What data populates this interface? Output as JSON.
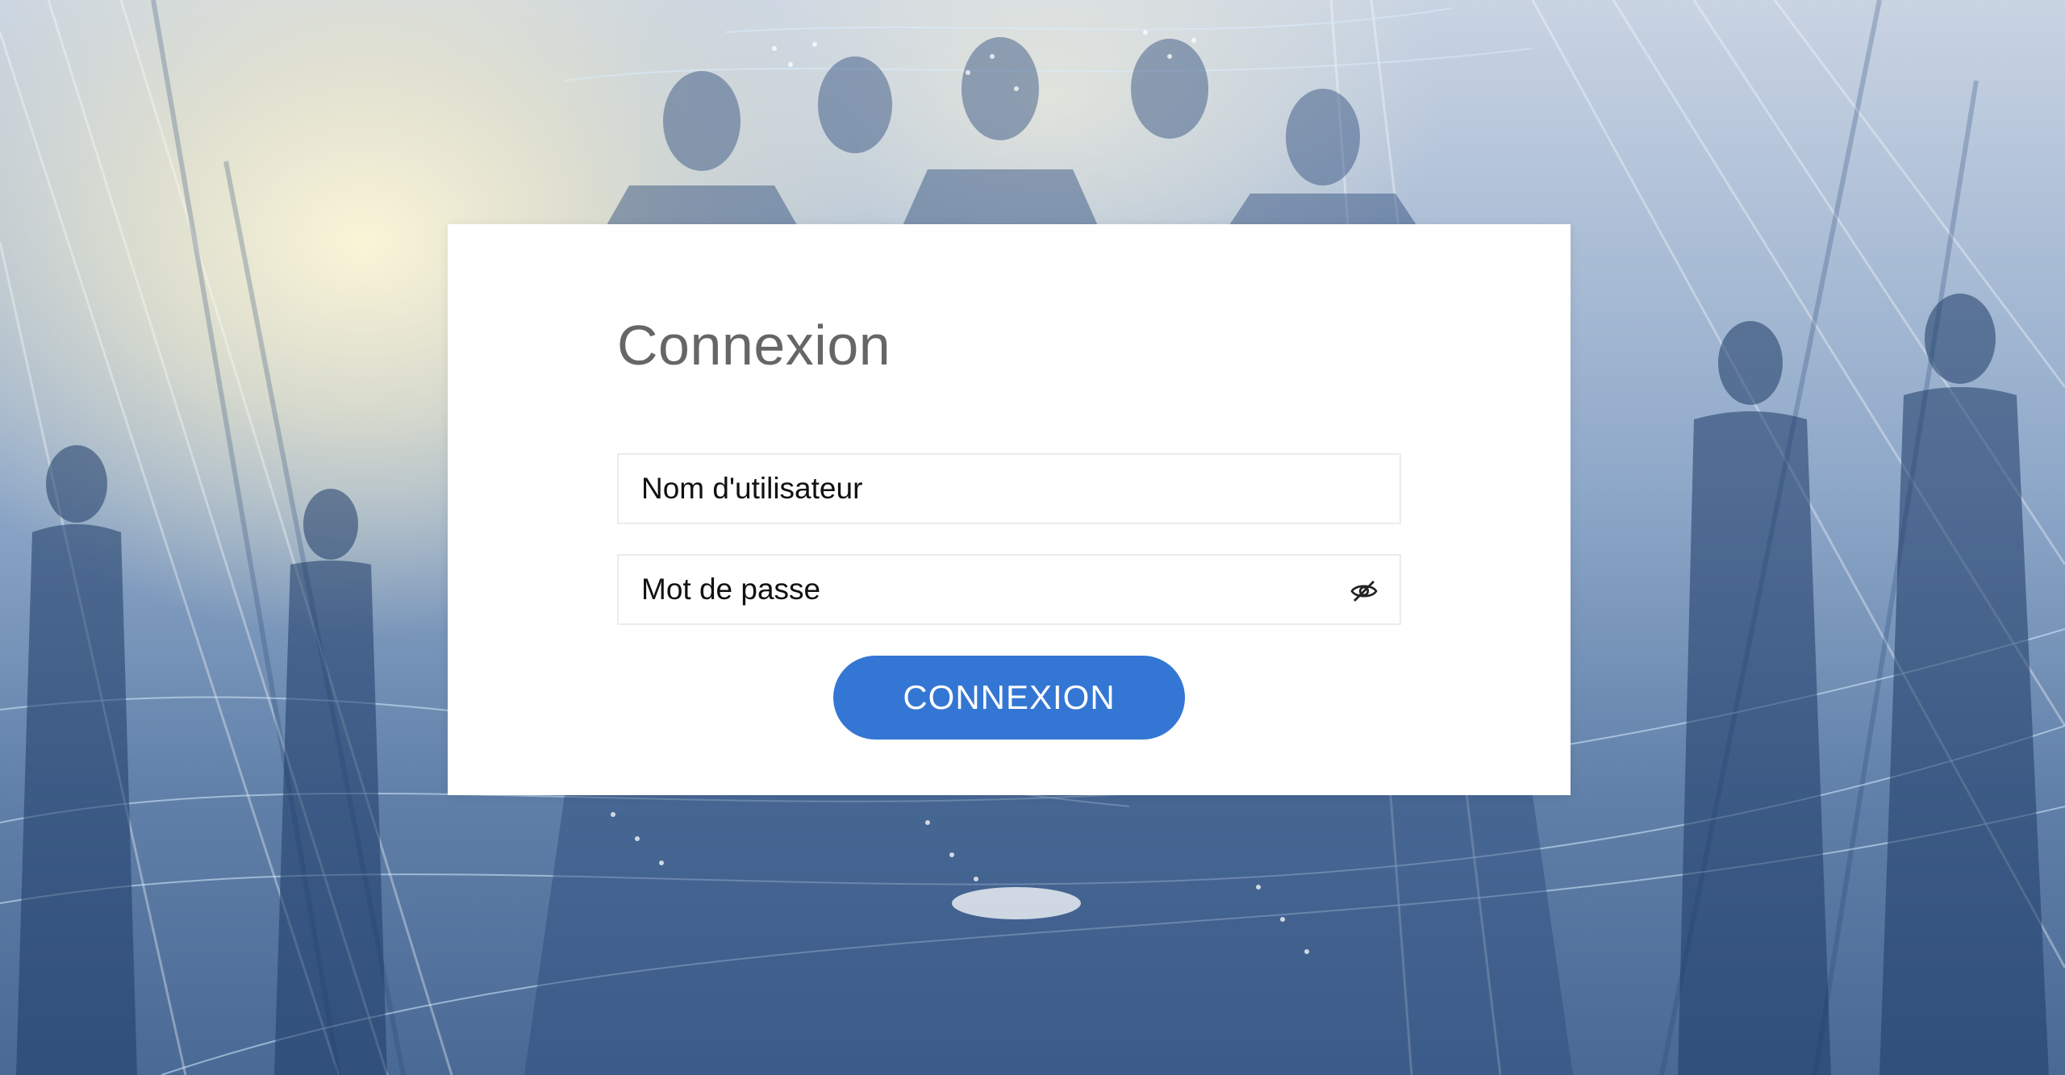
{
  "login": {
    "title": "Connexion",
    "username_placeholder": "Nom d'utilisateur",
    "password_placeholder": "Mot de passe",
    "submit_label": "CONNEXION",
    "password_toggle_icon": "eye-slash-icon"
  },
  "colors": {
    "accent": "#3476d4",
    "card": "#ffffff",
    "title": "#666666",
    "input_border": "#ececec"
  }
}
